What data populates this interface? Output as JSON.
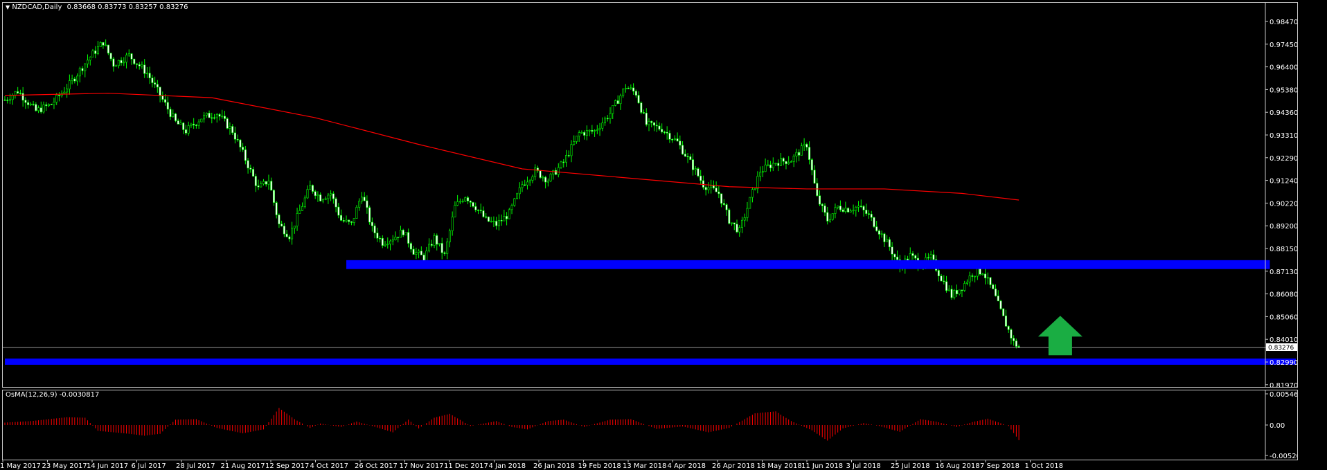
{
  "symbol_header": {
    "symbol": "NZDCAD,Daily",
    "ohlc": "0.83668 0.83773 0.83257 0.83276"
  },
  "indicator_header": {
    "label": "OsMA(12,26,9) -0.0030817"
  },
  "current_price": "0.83276",
  "price_axis": [
    "0.98470",
    "0.97450",
    "0.96400",
    "0.95380",
    "0.94360",
    "0.93310",
    "0.92290",
    "0.91240",
    "0.90220",
    "0.89200",
    "0.88150",
    "0.87130",
    "0.86080",
    "0.85060",
    "0.84010",
    "0.82990",
    "0.81970"
  ],
  "osma_axis": [
    "0.005467",
    "0.00",
    "-0.005209"
  ],
  "time_axis": [
    "1 May 2017",
    "23 May 2017",
    "14 Jun 2017",
    "6 Jul 2017",
    "28 Jul 2017",
    "21 Aug 2017",
    "12 Sep 2017",
    "4 Oct 2017",
    "26 Oct 2017",
    "17 Nov 2017",
    "11 Dec 2017",
    "4 Jan 2018",
    "26 Jan 2018",
    "19 Feb 2018",
    "13 Mar 2018",
    "4 Apr 2018",
    "26 Apr 2018",
    "18 May 2018",
    "11 Jun 2018",
    "3 Jul 2018",
    "25 Jul 2018",
    "16 Aug 2018",
    "7 Sep 2018",
    "1 Oct 2018"
  ],
  "chart_data": {
    "type": "candlestick",
    "symbol": "NZDCAD",
    "timeframe": "Daily",
    "ylim": [
      0.8197,
      0.9882
    ],
    "close_path": [
      [
        0,
        0.944
      ],
      [
        5,
        0.948
      ],
      [
        12,
        0.939
      ],
      [
        18,
        0.942
      ],
      [
        25,
        0.951
      ],
      [
        32,
        0.962
      ],
      [
        38,
        0.97
      ],
      [
        42,
        0.96
      ],
      [
        48,
        0.964
      ],
      [
        55,
        0.956
      ],
      [
        60,
        0.946
      ],
      [
        66,
        0.934
      ],
      [
        70,
        0.93
      ],
      [
        76,
        0.936
      ],
      [
        82,
        0.938
      ],
      [
        88,
        0.93
      ],
      [
        92,
        0.92
      ],
      [
        98,
        0.904
      ],
      [
        102,
        0.908
      ],
      [
        106,
        0.888
      ],
      [
        110,
        0.883
      ],
      [
        114,
        0.894
      ],
      [
        118,
        0.905
      ],
      [
        122,
        0.9
      ],
      [
        126,
        0.902
      ],
      [
        130,
        0.89
      ],
      [
        134,
        0.888
      ],
      [
        138,
        0.902
      ],
      [
        142,
        0.886
      ],
      [
        146,
        0.88
      ],
      [
        150,
        0.882
      ],
      [
        154,
        0.885
      ],
      [
        158,
        0.876
      ],
      [
        162,
        0.873
      ],
      [
        166,
        0.882
      ],
      [
        170,
        0.874
      ],
      [
        174,
        0.896
      ],
      [
        178,
        0.901
      ],
      [
        182,
        0.896
      ],
      [
        186,
        0.89
      ],
      [
        190,
        0.888
      ],
      [
        195,
        0.893
      ],
      [
        200,
        0.906
      ],
      [
        205,
        0.912
      ],
      [
        210,
        0.908
      ],
      [
        216,
        0.916
      ],
      [
        222,
        0.929
      ],
      [
        228,
        0.93
      ],
      [
        234,
        0.938
      ],
      [
        240,
        0.95
      ],
      [
        244,
        0.947
      ],
      [
        248,
        0.933
      ],
      [
        254,
        0.931
      ],
      [
        260,
        0.925
      ],
      [
        266,
        0.914
      ],
      [
        270,
        0.906
      ],
      [
        276,
        0.902
      ],
      [
        280,
        0.89
      ],
      [
        284,
        0.885
      ],
      [
        288,
        0.899
      ],
      [
        292,
        0.912
      ],
      [
        298,
        0.916
      ],
      [
        304,
        0.917
      ],
      [
        310,
        0.924
      ],
      [
        314,
        0.9
      ],
      [
        318,
        0.89
      ],
      [
        322,
        0.896
      ],
      [
        326,
        0.895
      ],
      [
        330,
        0.896
      ],
      [
        334,
        0.892
      ],
      [
        338,
        0.885
      ],
      [
        342,
        0.878
      ],
      [
        346,
        0.869
      ],
      [
        350,
        0.874
      ],
      [
        354,
        0.87
      ],
      [
        358,
        0.873
      ],
      [
        362,
        0.864
      ],
      [
        366,
        0.856
      ],
      [
        370,
        0.86
      ],
      [
        374,
        0.866
      ],
      [
        378,
        0.867
      ],
      [
        382,
        0.858
      ],
      [
        386,
        0.846
      ],
      [
        390,
        0.835
      ],
      [
        392,
        0.8328
      ]
    ],
    "ma_path": [
      [
        0,
        0.946
      ],
      [
        40,
        0.947
      ],
      [
        80,
        0.945
      ],
      [
        120,
        0.936
      ],
      [
        160,
        0.924
      ],
      [
        200,
        0.913
      ],
      [
        240,
        0.909
      ],
      [
        280,
        0.905
      ],
      [
        310,
        0.904
      ],
      [
        340,
        0.904
      ],
      [
        370,
        0.902
      ],
      [
        392,
        0.899
      ]
    ],
    "ma_color": "#ff0000",
    "candle_color": "#00ff00",
    "zones": [
      {
        "from_bar": 132,
        "to_bar": 489,
        "high": 0.872,
        "low": 0.868,
        "color": "#0000ff"
      },
      {
        "from_bar": 0,
        "to_bar": 500,
        "high": 0.8278,
        "low": 0.825,
        "color": "#0000ff"
      }
    ],
    "arrow": {
      "bar": 408,
      "price": 0.847,
      "direction": "up",
      "color": "#1aad43"
    },
    "osma": {
      "ylim": [
        -0.005209,
        0.005467
      ],
      "color": "#ff0000",
      "anchors": [
        [
          0,
          0.0005
        ],
        [
          10,
          0.0008
        ],
        [
          24,
          0.0016
        ],
        [
          31,
          0.0015
        ],
        [
          36,
          -0.0012
        ],
        [
          48,
          -0.0018
        ],
        [
          54,
          -0.0022
        ],
        [
          60,
          -0.0018
        ],
        [
          66,
          0.0011
        ],
        [
          74,
          0.0012
        ],
        [
          82,
          -0.0006
        ],
        [
          92,
          -0.0017
        ],
        [
          100,
          -0.0009
        ],
        [
          106,
          0.0035
        ],
        [
          112,
          0.0012
        ],
        [
          118,
          -0.0006
        ],
        [
          122,
          0.0003
        ],
        [
          130,
          -0.0004
        ],
        [
          136,
          0.0007
        ],
        [
          142,
          -0.0002
        ],
        [
          150,
          -0.0015
        ],
        [
          156,
          0.0011
        ],
        [
          160,
          -0.0007
        ],
        [
          166,
          0.0015
        ],
        [
          172,
          0.0023
        ],
        [
          180,
          -0.0002
        ],
        [
          190,
          0.0008
        ],
        [
          196,
          -0.0004
        ],
        [
          202,
          -0.0009
        ],
        [
          210,
          0.0008
        ],
        [
          216,
          0.0011
        ],
        [
          224,
          -0.0004
        ],
        [
          234,
          0.0011
        ],
        [
          242,
          0.0012
        ],
        [
          252,
          -0.0008
        ],
        [
          262,
          -0.0003
        ],
        [
          272,
          -0.0015
        ],
        [
          280,
          -0.0006
        ],
        [
          290,
          0.0024
        ],
        [
          298,
          0.0028
        ],
        [
          304,
          0.0008
        ],
        [
          312,
          -0.0011
        ],
        [
          318,
          -0.0032
        ],
        [
          324,
          -0.0007
        ],
        [
          332,
          0.0004
        ],
        [
          338,
          -0.0002
        ],
        [
          346,
          -0.0014
        ],
        [
          354,
          0.0012
        ],
        [
          360,
          0.0007
        ],
        [
          368,
          -0.0004
        ],
        [
          374,
          0.0006
        ],
        [
          380,
          0.0013
        ],
        [
          388,
          -0.0002
        ],
        [
          392,
          -0.0031
        ]
      ]
    }
  }
}
